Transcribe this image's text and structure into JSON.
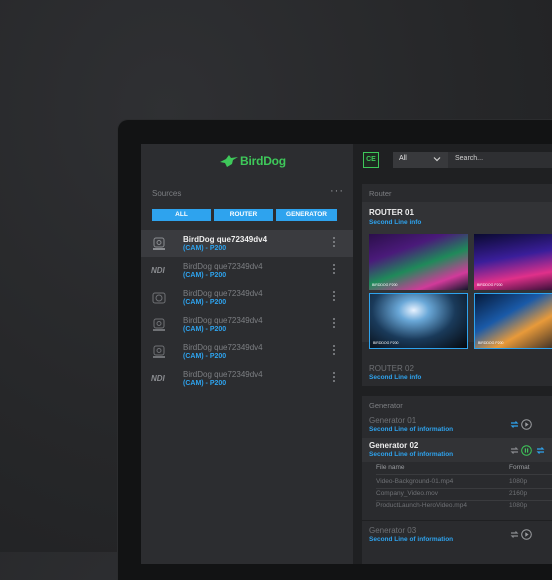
{
  "brand": {
    "name": "BirdDog",
    "color": "#3ec85a"
  },
  "accent": "#2ea3ee",
  "sources": {
    "title": "Sources",
    "more": "···",
    "filters": [
      "ALL",
      "ROUTER",
      "GENERATOR"
    ],
    "items": [
      {
        "icon": "ptz-camera-icon",
        "name": "BirdDog que72349dv4",
        "sub": "(CAM) - P200",
        "active": true
      },
      {
        "icon": "ndi-icon",
        "icon_text": "NDI",
        "name": "BirdDog que72349dv4",
        "sub": "(CAM) - P200",
        "active": false
      },
      {
        "icon": "box-camera-icon",
        "name": "BirdDog que72349dv4",
        "sub": "(CAM) - P200",
        "active": false
      },
      {
        "icon": "ptz-camera-icon",
        "name": "BirdDog que72349dv4",
        "sub": "(CAM) - P200",
        "active": false
      },
      {
        "icon": "ptz-camera-icon",
        "name": "BirdDog que72349dv4",
        "sub": "(CAM) - P200",
        "active": false
      },
      {
        "icon": "ndi-icon",
        "icon_text": "NDI",
        "name": "BirdDog que72349dv4",
        "sub": "(CAM) - P200",
        "active": false
      }
    ]
  },
  "topbar": {
    "badge": "CE",
    "select_value": "All",
    "search_placeholder": "Search..."
  },
  "router": {
    "title": "Router",
    "items": [
      {
        "name": "ROUTER 01",
        "sub": "Second Line info"
      },
      {
        "name": "ROUTER 02",
        "sub": "Second Line info"
      }
    ],
    "thumb_caption": "BIRDDOG P200"
  },
  "generator": {
    "title": "Generator",
    "items": [
      {
        "name": "Generator 01",
        "sub": "Second Line of information"
      },
      {
        "name": "Generator 02",
        "sub": "Second Line of information"
      },
      {
        "name": "Generator 03",
        "sub": "Second Line of information"
      }
    ],
    "table": {
      "headers": [
        "File name",
        "Format"
      ],
      "rows": [
        [
          "Video-Background-01.mp4",
          "1080p"
        ],
        [
          "Company_Video.mov",
          "2160p"
        ],
        [
          "ProductLaunch-HeroVideo.mp4",
          "1080p"
        ]
      ]
    }
  }
}
